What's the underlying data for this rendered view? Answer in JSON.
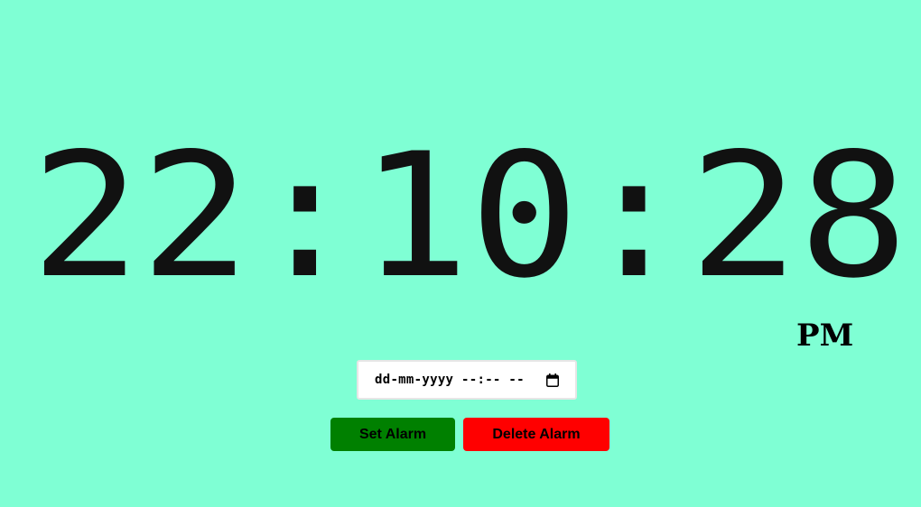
{
  "clock": {
    "time": "22:10:28",
    "period": "PM"
  },
  "alarm": {
    "datetime_placeholder": "dd-mm-yyyy --:-- --",
    "calendar_icon": "calendar-icon",
    "set_label": "Set Alarm",
    "delete_label": "Delete Alarm"
  },
  "colors": {
    "background": "#7fffd4",
    "digits": "#111111",
    "set_button": "#008000",
    "delete_button": "#ff0000"
  }
}
